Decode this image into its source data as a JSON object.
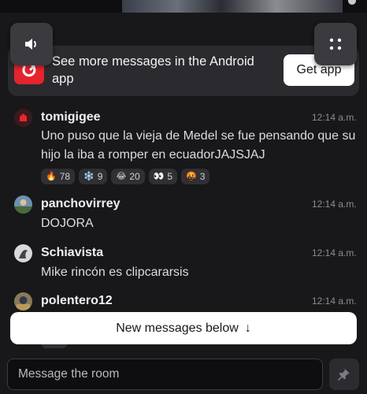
{
  "banner": {
    "text": "See more messages in the Android app",
    "button_label": "Get app",
    "logo_icon": "app-logo-icon",
    "brand_color": "#e5242f"
  },
  "controls": {
    "speaker_icon": "speaker-icon",
    "grid_icon": "grid-icon"
  },
  "messages": [
    {
      "username": "tomigigee",
      "timestamp": "12:14 a.m.",
      "text": "Uno puso que la vieja de Medel se fue pensando que su hijo la iba a romper en ecuadorJAJSJAJ",
      "reactions": [
        {
          "emoji": "🔥",
          "count": "78"
        },
        {
          "emoji": "❄️",
          "count": "9"
        },
        {
          "emoji": "😂",
          "count": "20"
        },
        {
          "emoji": "👀",
          "count": "5"
        },
        {
          "emoji": "🤬",
          "count": "3"
        }
      ]
    },
    {
      "username": "panchovirrey",
      "timestamp": "12:14 a.m.",
      "text": "DOJORA"
    },
    {
      "username": "Schiavista",
      "timestamp": "12:14 a.m.",
      "text": "Mike rincón es clipcararsis"
    },
    {
      "username": "polentero12",
      "timestamp": "12:14 a.m."
    }
  ],
  "new_messages_button": {
    "label": "New messages below",
    "arrow": "↓"
  },
  "composer": {
    "placeholder": "Message the room",
    "pin_icon": "pin-icon"
  }
}
